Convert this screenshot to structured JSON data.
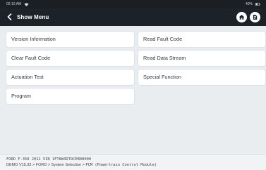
{
  "status_bar": {
    "time": "02:10 AM",
    "battery": "40%"
  },
  "header": {
    "title": "Show Menu",
    "icons": {
      "back": "chevron-left-icon",
      "home": "home-icon",
      "info": "info-icon"
    }
  },
  "menu": {
    "items": [
      {
        "label": "Version Information"
      },
      {
        "label": "Read Fault Code"
      },
      {
        "label": "Clear Fault Code"
      },
      {
        "label": "Read Data Stream"
      },
      {
        "label": "Actuation Test"
      },
      {
        "label": "Special Function"
      },
      {
        "label": "Program"
      }
    ]
  },
  "footer": {
    "vehicle_info": "FORD  F-350  2012  VIN  1FT8W3DT9CEB00000",
    "breadcrumb_prefix": "DEMO V15.32 > FORD > System Selection > ",
    "breadcrumb_module": "PCM (Powertrain Control Module)"
  },
  "colors": {
    "topbar": "#1d2228",
    "statusbar": "#1b1f24",
    "background": "#e9edf0",
    "card": "#ffffff",
    "text": "#353b41"
  }
}
